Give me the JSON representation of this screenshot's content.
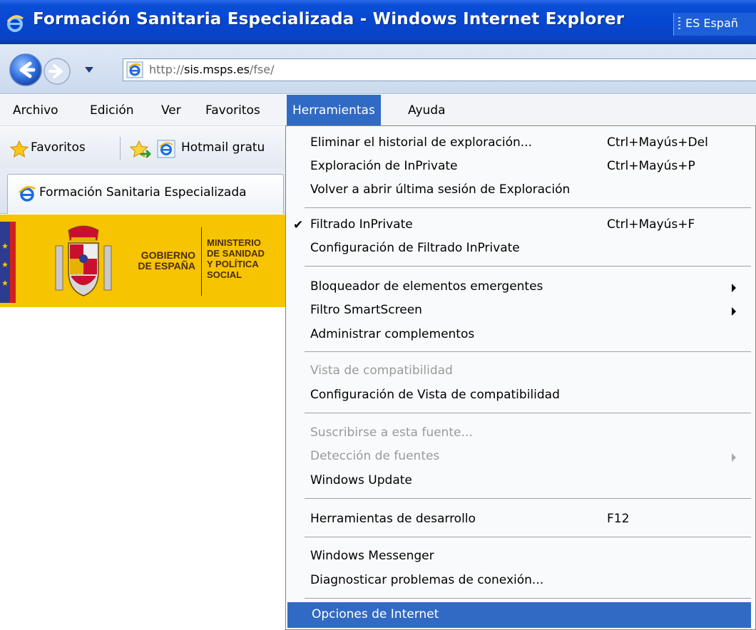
{
  "window": {
    "title": "Formación Sanitaria Especializada - Windows Internet Explorer",
    "language_indicator": "ES Españ",
    "icon": "ie-icon"
  },
  "address_bar": {
    "url_prefix": "http://",
    "url_domain": "sis.msps.es",
    "url_path": "/fse/",
    "buttons": [
      "back-icon",
      "forward-icon",
      "dropdown-arrow-icon"
    ]
  },
  "menu_bar": {
    "items": [
      "Archivo",
      "Edición",
      "Ver",
      "Favoritos",
      "Herramientas",
      "Ayuda"
    ],
    "active": "Herramientas"
  },
  "favorites_bar": {
    "favorites_label": "Favoritos",
    "link_label": "Hotmail gratu"
  },
  "tab": {
    "label": "Formación Sanitaria Especializada"
  },
  "banner": {
    "gobierno_line1": "GOBIERNO",
    "gobierno_line2": "DE ESPAÑA",
    "ministry_line1": "MINISTERIO",
    "ministry_line2": "DE SANIDAD",
    "ministry_line3": "Y POLÍTICA",
    "ministry_line4": "SOCIAL"
  },
  "tools_menu": {
    "items": [
      {
        "label": "Eliminar el historial de exploración...",
        "shortcut": "Ctrl+Mayús+Del"
      },
      {
        "label": "Exploración de InPrivate",
        "shortcut": "Ctrl+Mayús+P"
      },
      {
        "label": "Volver a abrir última sesión de Exploración",
        "shortcut": ""
      },
      {
        "label": "Filtrado InPrivate",
        "shortcut": "Ctrl+Mayús+F",
        "checked": true
      },
      {
        "label": "Configuración de Filtrado InPrivate",
        "shortcut": ""
      },
      {
        "label": "Bloqueador de elementos emergentes",
        "shortcut": "",
        "submenu": true
      },
      {
        "label": "Filtro SmartScreen",
        "shortcut": "",
        "submenu": true
      },
      {
        "label": "Administrar complementos",
        "shortcut": ""
      },
      {
        "label": "Vista de compatibilidad",
        "shortcut": "",
        "disabled": true
      },
      {
        "label": "Configuración de Vista de compatibilidad",
        "shortcut": ""
      },
      {
        "label": "Suscribirse a esta fuente...",
        "shortcut": "",
        "disabled": true
      },
      {
        "label": "Detección de fuentes",
        "shortcut": "",
        "disabled": true,
        "submenu": true
      },
      {
        "label": "Windows Update",
        "shortcut": ""
      },
      {
        "label": "Herramientas de desarrollo",
        "shortcut": "F12"
      },
      {
        "label": "Windows Messenger",
        "shortcut": ""
      },
      {
        "label": "Diagnosticar problemas de conexión...",
        "shortcut": ""
      },
      {
        "label": "Opciones de Internet",
        "shortcut": "",
        "highlighted": true
      }
    ],
    "check_mark": "✔"
  },
  "colors": {
    "titlebar": "#0646d0",
    "menu_highlight": "#316ac5",
    "banner_yellow": "#f6c400",
    "disabled_text": "#9a9a9a"
  }
}
